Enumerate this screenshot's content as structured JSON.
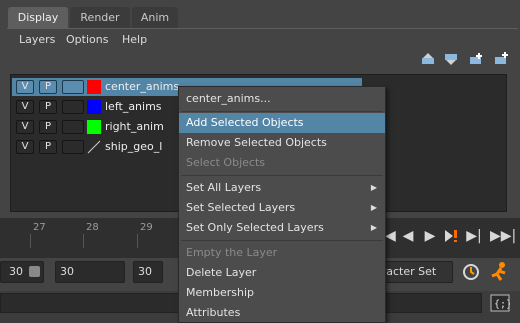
{
  "tabs": [
    "Display",
    "Render",
    "Anim"
  ],
  "menubar": [
    "Layers",
    "Options",
    "Help"
  ],
  "layers": [
    {
      "v": "V",
      "p": "P",
      "color": "#ff0000",
      "name": "center_anims",
      "selected": true
    },
    {
      "v": "V",
      "p": "P",
      "color": "#0000ff",
      "name": "left_anims",
      "selected": false
    },
    {
      "v": "V",
      "p": "P",
      "color": "#00ff00",
      "name": "right_anim",
      "selected": false
    },
    {
      "v": "V",
      "p": "P",
      "color": "none",
      "name": "ship_geo_l",
      "selected": false
    }
  ],
  "timeline": {
    "ticks": [
      "27",
      "28",
      "29"
    ]
  },
  "range": {
    "start_field": "30",
    "end_field": "30",
    "field3": "30",
    "character_set": "aracter Set"
  },
  "context_menu": {
    "title": "center_anims...",
    "items": [
      {
        "label": "Add Selected Objects",
        "state": "highlighted"
      },
      {
        "label": "Remove Selected Objects",
        "state": "normal"
      },
      {
        "label": "Select Objects",
        "state": "disabled"
      },
      {
        "label": "Set All Layers",
        "state": "submenu"
      },
      {
        "label": "Set Selected Layers",
        "state": "submenu"
      },
      {
        "label": "Set Only Selected Layers",
        "state": "submenu"
      },
      {
        "label": "Empty the Layer",
        "state": "disabled"
      },
      {
        "label": "Delete Layer",
        "state": "normal"
      },
      {
        "label": "Membership",
        "state": "normal"
      },
      {
        "label": "Attributes",
        "state": "normal"
      }
    ]
  },
  "colors": {
    "selection": "#5285a6",
    "panel": "#444444",
    "list_bg": "#2b2b2b"
  },
  "icons": [
    "move-layer-up-icon",
    "move-layer-down-icon",
    "new-layer-icon",
    "new-layer-from-selected-icon",
    "play-back-icon",
    "play-forward-icon",
    "key-icon",
    "step-end-icon",
    "runner-icon",
    "character-set-icon",
    "script-editor-icon"
  ]
}
